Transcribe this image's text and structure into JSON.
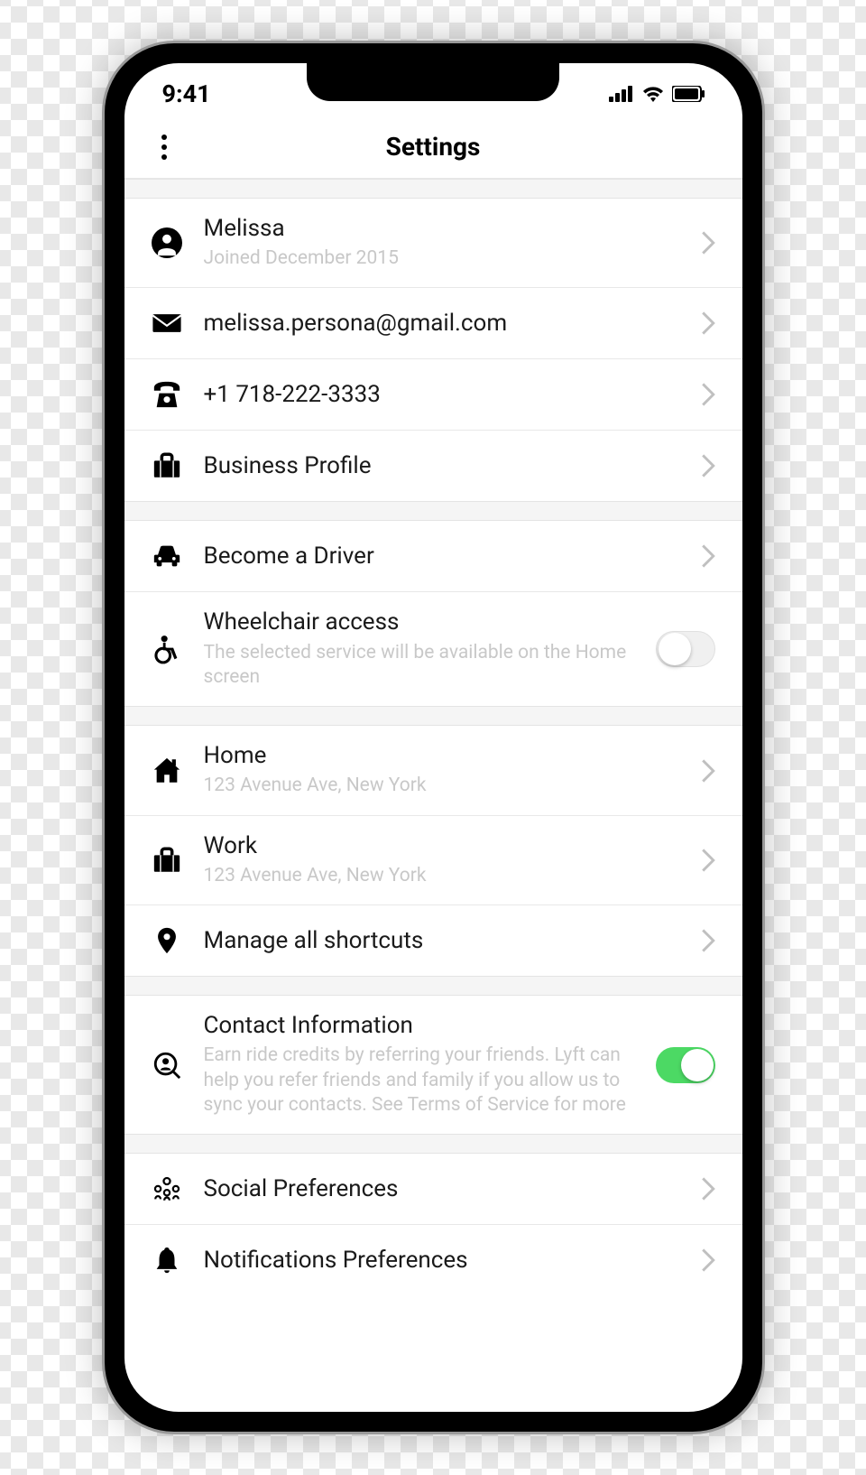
{
  "status_bar": {
    "time": "9:41"
  },
  "header": {
    "title": "Settings"
  },
  "profile": {
    "name": "Melissa",
    "joined": "Joined December 2015",
    "email": "melissa.persona@gmail.com",
    "phone": "+1 718-222-3333",
    "business": "Business Profile"
  },
  "driver": {
    "become": "Become a Driver",
    "wheelchair": "Wheelchair access",
    "wheelchair_sub": "The selected service will be available on the Home screen",
    "wheelchair_on": false
  },
  "places": {
    "home": "Home",
    "home_addr": "123 Avenue Ave, New York",
    "work": "Work",
    "work_addr": "123 Avenue Ave, New York",
    "manage": "Manage all shortcuts"
  },
  "contact": {
    "title": "Contact Information",
    "sub": "Earn ride credits by referring your friends. Lyft can help you refer friends and family if you allow us to sync your contacts. See Terms of Service for more",
    "on": true
  },
  "prefs": {
    "social": "Social Preferences",
    "notifications": "Notifications Preferences"
  }
}
